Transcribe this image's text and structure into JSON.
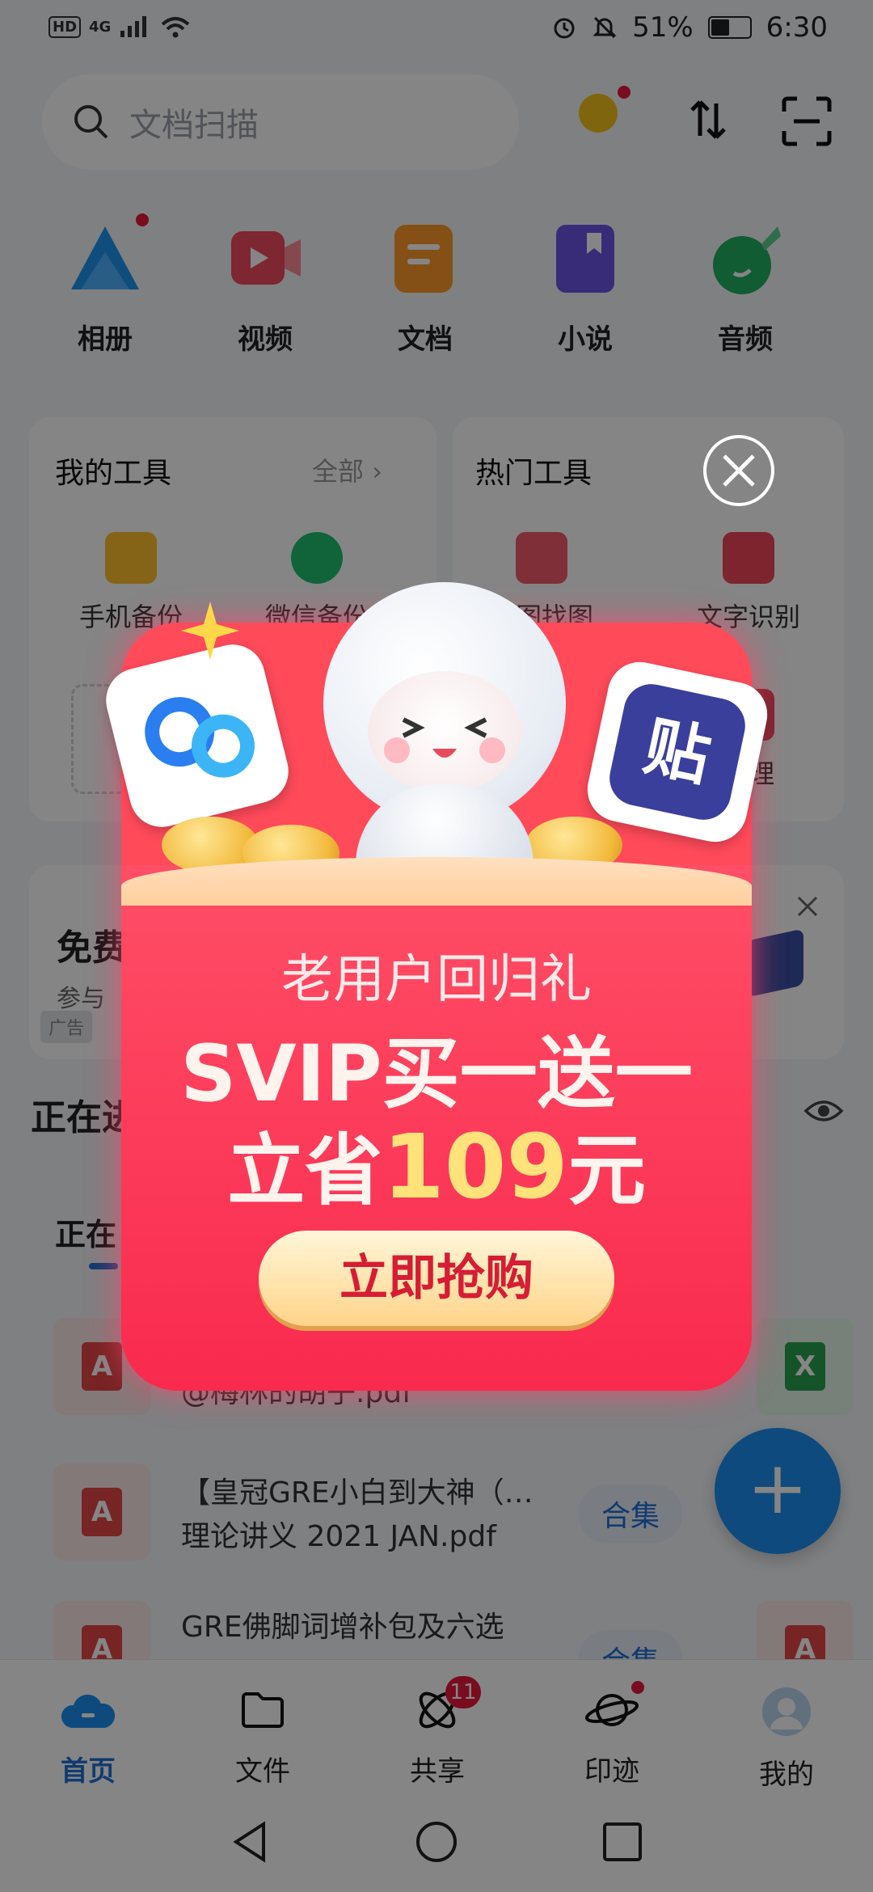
{
  "status_bar": {
    "left_badges": [
      "HD",
      "4G"
    ],
    "battery": "51%",
    "time": "6:30",
    "battery_fraction": 0.51
  },
  "search": {
    "placeholder": "文档扫描"
  },
  "categories": [
    {
      "label": "相册",
      "icon": "album-icon"
    },
    {
      "label": "视频",
      "icon": "video-icon"
    },
    {
      "label": "文档",
      "icon": "document-icon"
    },
    {
      "label": "小说",
      "icon": "novel-icon"
    },
    {
      "label": "音频",
      "icon": "audio-icon"
    }
  ],
  "my_tools": {
    "title": "我的工具",
    "more": "全部",
    "items": [
      {
        "label": "手机备份"
      },
      {
        "label": "微信备份"
      }
    ]
  },
  "hot_tools": {
    "title": "热门工具",
    "items": [
      {
        "label": "以图找图"
      },
      {
        "label": "文字识别"
      },
      {
        "label": "清理"
      }
    ]
  },
  "ad": {
    "title": "免费",
    "subtitle": "参与",
    "tag": "广告"
  },
  "section": {
    "title": "正在进行",
    "tab": "正在"
  },
  "files": [
    {
      "name_line1": "@梅林的胡子.pdf",
      "name_line2": "",
      "chip": ""
    },
    {
      "name_line1": "【皇冠GRE小白到大神（…",
      "name_line2": "理论讲义 2021 JAN.pdf",
      "chip": "合集"
    },
    {
      "name_line1": "GRE佛脚词增补包及六选",
      "name_line2": "",
      "chip": "合集"
    }
  ],
  "bottom_nav": [
    {
      "label": "首页",
      "icon": "cloud-home-icon",
      "active": true
    },
    {
      "label": "文件",
      "icon": "folder-icon"
    },
    {
      "label": "共享",
      "icon": "share-icon",
      "badge": "11"
    },
    {
      "label": "印迹",
      "icon": "planet-icon"
    },
    {
      "label": "我的",
      "icon": "avatar-icon"
    }
  ],
  "popup": {
    "line1": "老用户回归礼",
    "line2": "SVIP买一送一",
    "line3_prefix": "立省",
    "line3_amount": "109",
    "line3_suffix": "元",
    "button": "立即抢购",
    "card_right_text": "贴"
  },
  "colors": {
    "accent": "#1f6fd6",
    "popup_red": "#f8234a",
    "popup_gold": "#ffe27a"
  }
}
